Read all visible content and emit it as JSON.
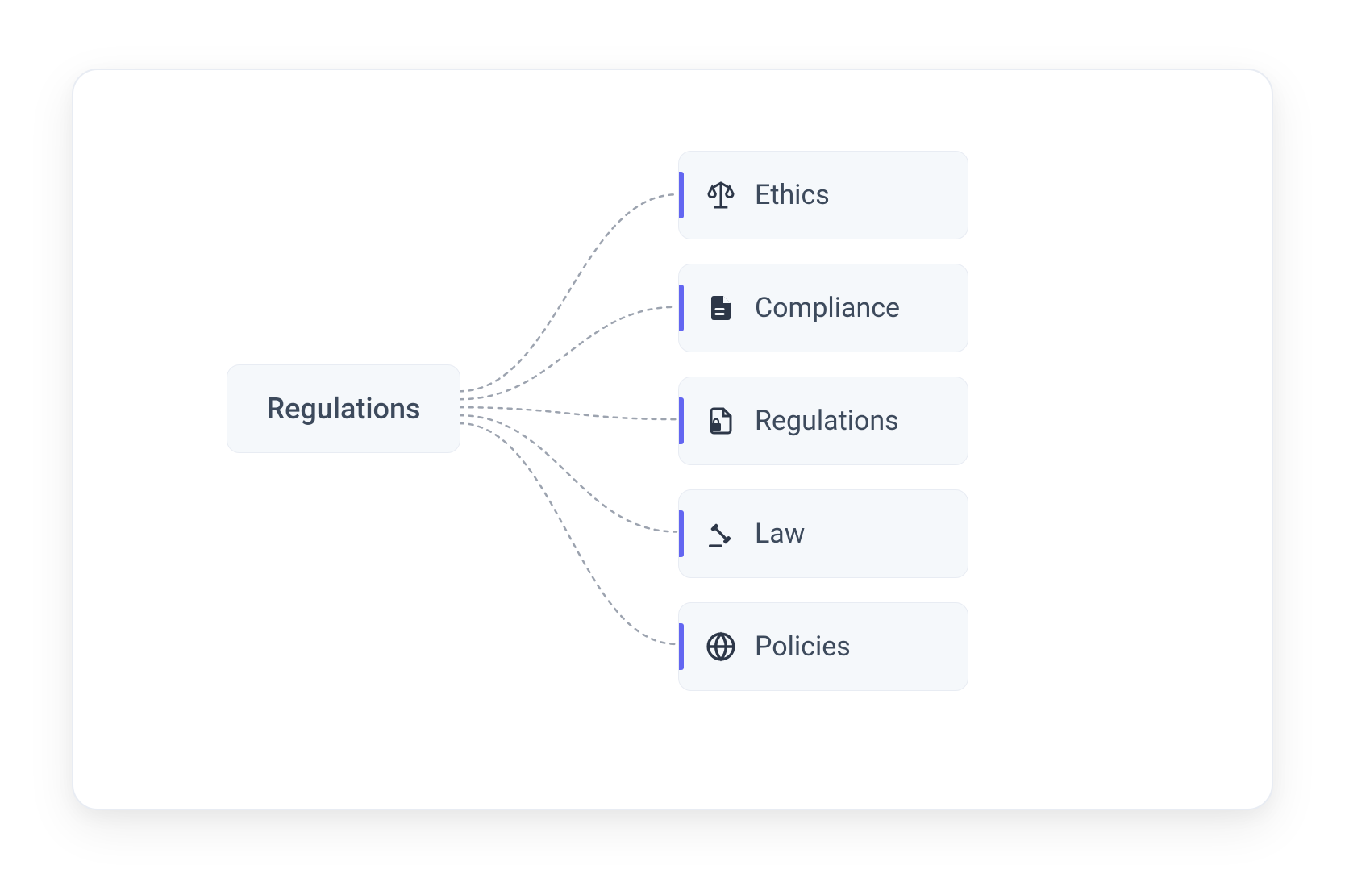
{
  "diagram": {
    "root": {
      "label": "Regulations"
    },
    "children": [
      {
        "label": "Ethics",
        "icon": "scales"
      },
      {
        "label": "Compliance",
        "icon": "document"
      },
      {
        "label": "Regulations",
        "icon": "secure-document"
      },
      {
        "label": "Law",
        "icon": "gavel"
      },
      {
        "label": "Policies",
        "icon": "globe"
      }
    ],
    "colors": {
      "accent": "#6366f1",
      "nodeBg": "#f5f8fb",
      "nodeBorder": "#e8ecf3",
      "text": "#3d4a5c",
      "iconColor": "#2d3748",
      "connector": "#9ca3af"
    }
  }
}
